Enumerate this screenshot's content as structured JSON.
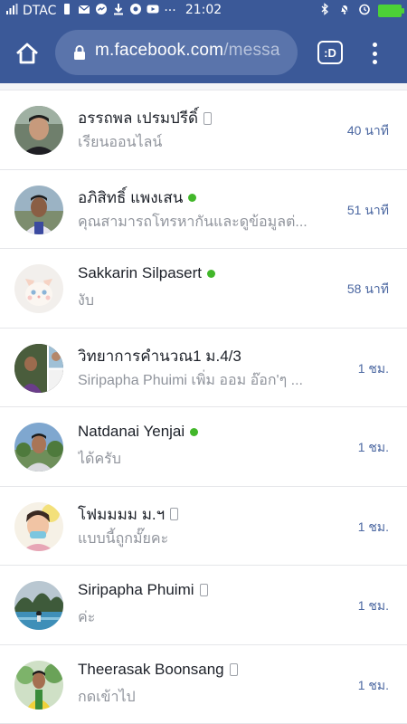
{
  "status_bar": {
    "carrier": "DTAC",
    "time": "21:02",
    "more": "···"
  },
  "browser": {
    "url_main": "m.facebook.com",
    "url_rest": "/messa",
    "tab_label": ":D"
  },
  "conversations": [
    {
      "name": "อรรถพล เปรมปรีดิ์",
      "preview": "เรียนออนไลน์",
      "time": "40 นาที",
      "indicator": "phone"
    },
    {
      "name": "อภิสิทธิ์ แพงเสน",
      "preview": "คุณสามารถโทรหากันและดูข้อมูลต่...",
      "time": "51 นาที",
      "indicator": "online"
    },
    {
      "name": "Sakkarin Silpasert",
      "preview": "งับ",
      "time": "58 นาที",
      "indicator": "online"
    },
    {
      "name": "วิทยาการคำนวณ1 ม.4/3",
      "preview": "Siripapha Phuimi เพิ่ม ออม อ๊อก'ๆ ...",
      "time": "1 ชม.",
      "indicator": "none"
    },
    {
      "name": "Natdanai Yenjai",
      "preview": "ได้ครับ",
      "time": "1 ชม.",
      "indicator": "online"
    },
    {
      "name": "โฟมมมม ม.ฯ",
      "preview": "แบบนี้ถูกมั๊ยคะ",
      "time": "1 ชม.",
      "indicator": "phone"
    },
    {
      "name": "Siripapha Phuimi",
      "preview": "ค่ะ",
      "time": "1 ชม.",
      "indicator": "phone"
    },
    {
      "name": "Theerasak Boonsang",
      "preview": "กดเข้าไป",
      "time": "1 ชม.",
      "indicator": "phone"
    }
  ],
  "colors": {
    "brand": "#3b5998",
    "online": "#42b72a",
    "time_text": "#4b67a1"
  }
}
